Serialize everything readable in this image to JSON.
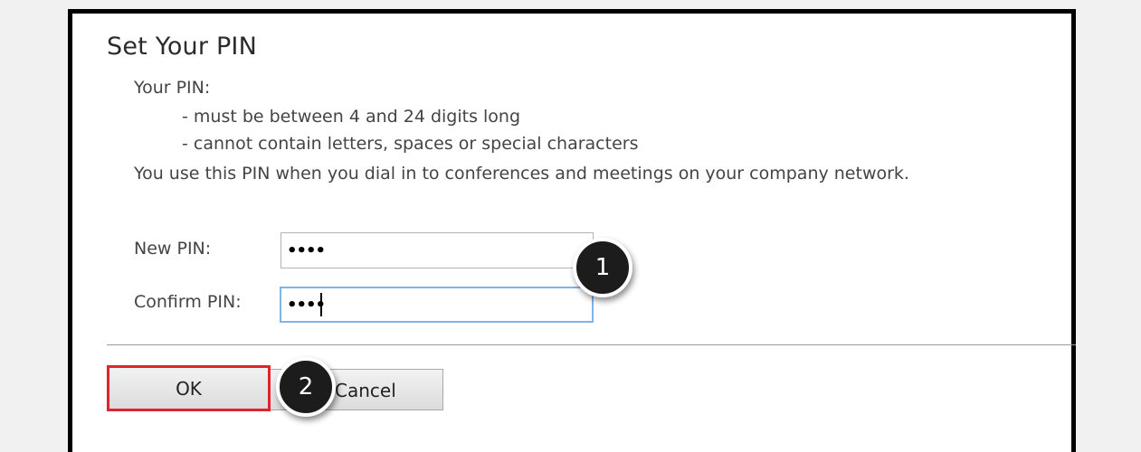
{
  "dialog": {
    "title": "Set Your PIN",
    "intro": "Your PIN:",
    "rule1": "- must be between 4 and 24 digits long",
    "rule2": "- cannot contain letters, spaces or special characters",
    "usage": "You use this PIN when you dial in to conferences and meetings on your company network."
  },
  "form": {
    "new_pin_label": "New PIN:",
    "new_pin_value": "••••",
    "confirm_pin_label": "Confirm PIN:",
    "confirm_pin_value": "••••"
  },
  "buttons": {
    "ok": "OK",
    "cancel": "Cancel"
  },
  "callouts": {
    "first": "1",
    "second": "2"
  },
  "colors": {
    "highlight": "#e0242b",
    "focus_border": "#7eb4ea",
    "callout_fill": "#1c1c1c"
  }
}
